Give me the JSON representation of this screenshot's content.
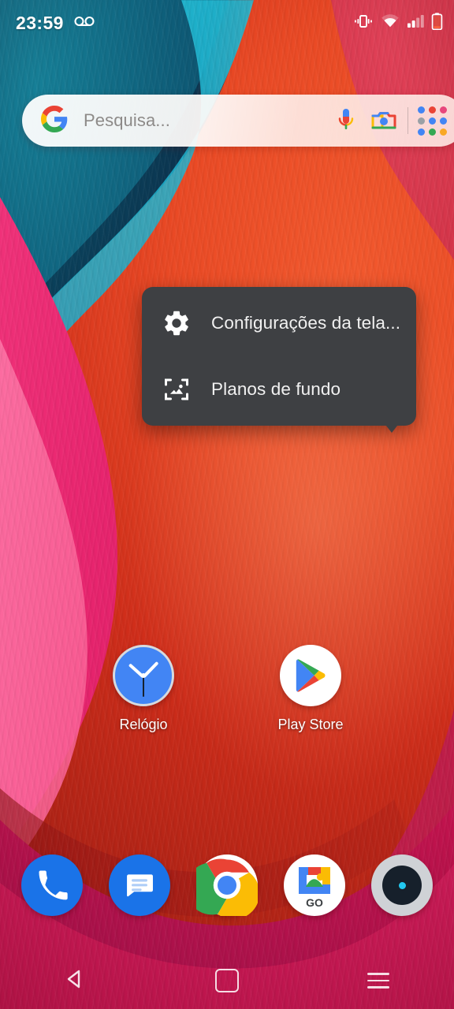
{
  "status_bar": {
    "clock": "23:59",
    "left_icons": [
      {
        "name": "voicemail-icon",
        "glyph": "voicemail"
      }
    ],
    "right_icons": [
      {
        "name": "vibrate-icon",
        "glyph": "vibrate"
      },
      {
        "name": "wifi-icon",
        "glyph": "wifi"
      },
      {
        "name": "cellular-signal-icon",
        "glyph": "signal"
      },
      {
        "name": "battery-icon",
        "glyph": "battery-low"
      }
    ]
  },
  "search": {
    "placeholder": "Pesquisa...",
    "google_logo": "google-g-icon",
    "mic_icon": "microphone-icon",
    "lens_icon": "google-lens-camera-icon",
    "apps_grid_icon": "google-apps-grid-icon",
    "grid_dot_colors": [
      "#4285f4",
      "#ea4335",
      "#e8467c",
      "#9aa0a6",
      "#4285f4",
      "#4285f4",
      "#4285f4",
      "#34a853",
      "#f9a825"
    ]
  },
  "popup_menu": {
    "items": [
      {
        "label": "Configurações da tela...",
        "icon": "settings-gear-icon"
      },
      {
        "label": "Planos de fundo",
        "icon": "wallpaper-image-icon"
      }
    ],
    "background_color": "#3e4043",
    "text_color": "#f1f1f1"
  },
  "home_apps": [
    {
      "label": "Relógio",
      "icon": "clock-app-icon"
    },
    {
      "label": "Play Store",
      "icon": "play-store-app-icon"
    }
  ],
  "dock_apps": [
    {
      "label": "Telefone",
      "icon": "phone-app-icon"
    },
    {
      "label": "Mensagens",
      "icon": "messages-app-icon"
    },
    {
      "label": "Chrome",
      "icon": "chrome-app-icon"
    },
    {
      "label": "Gallery GO",
      "icon": "gallery-go-app-icon",
      "badge_text": "GO"
    },
    {
      "label": "Câmera",
      "icon": "camera-app-icon"
    }
  ],
  "nav_bar": {
    "back": "back-nav-button",
    "home": "home-nav-button",
    "recents": "recents-nav-button"
  },
  "wallpaper": {
    "name": "abstract-swirl-wallpaper",
    "colors": {
      "teal": "#0e5f7b",
      "cyan": "#27c8e0",
      "orange_red": "#ea4a25",
      "crimson": "#cf2f46",
      "magenta": "#e01e62",
      "pink": "#fb5d93"
    }
  }
}
